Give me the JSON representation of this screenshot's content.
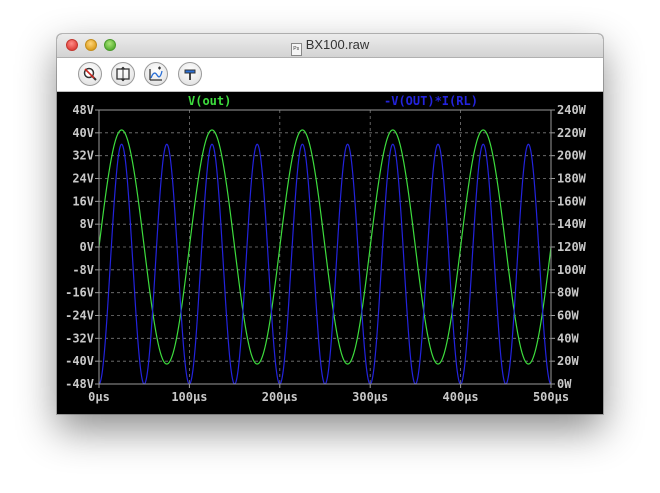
{
  "window": {
    "title": "BX100.raw",
    "file_icon_label": "Ps"
  },
  "toolbar": {
    "buttons": [
      {
        "name": "zoom-icon",
        "label": "Zoom"
      },
      {
        "name": "autorange-icon",
        "label": "Autorange"
      },
      {
        "name": "add-trace-icon",
        "label": "Add trace"
      },
      {
        "name": "probe-icon",
        "label": "Probe"
      }
    ]
  },
  "chart_data": {
    "type": "line",
    "x_ticks": [
      "0µs",
      "100µs",
      "200µs",
      "300µs",
      "400µs",
      "500µs"
    ],
    "y_left_ticks": [
      "48V",
      "40V",
      "32V",
      "24V",
      "16V",
      "8V",
      "0V",
      "-8V",
      "-16V",
      "-24V",
      "-32V",
      "-40V",
      "-48V"
    ],
    "y_right_ticks": [
      "240W",
      "220W",
      "200W",
      "180W",
      "160W",
      "140W",
      "120W",
      "100W",
      "80W",
      "60W",
      "40W",
      "20W",
      "0W"
    ],
    "xlim": [
      0,
      500
    ],
    "ylim_left": [
      -48,
      48
    ],
    "ylim_right": [
      0,
      240
    ],
    "grid": true,
    "series": [
      {
        "name": "V(out)",
        "axis": "left",
        "color": "#3ddc3d",
        "shape": "sine",
        "amplitude": 41,
        "offset": 0,
        "frequency_khz": 10
      },
      {
        "name": "-V(OUT)*I(RL)",
        "axis": "right",
        "color": "#2323dd",
        "shape": "sine-squared",
        "peak": 210,
        "min": 0,
        "frequency_khz": 20
      }
    ]
  }
}
